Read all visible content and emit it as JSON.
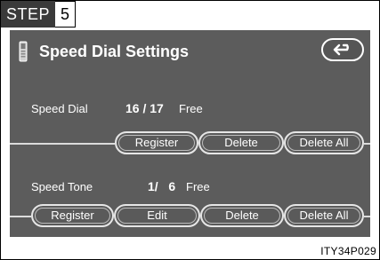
{
  "step": {
    "label": "STEP",
    "number": "5"
  },
  "header": {
    "title": "Speed Dial Settings",
    "icons": {
      "phone": "phone-icon",
      "back": "back-arrow-icon"
    }
  },
  "speed_dial": {
    "label": "Speed Dial",
    "count": "16 / 17",
    "free": "Free",
    "buttons": [
      "Register",
      "Delete",
      "Delete All"
    ]
  },
  "speed_tone": {
    "label": "Speed Tone",
    "count": "1/   6",
    "free": "Free",
    "buttons": [
      "Register",
      "Edit",
      "Delete",
      "Delete All"
    ]
  },
  "caption": "ITY34P029",
  "colors": {
    "screen": "#5c5c5c",
    "text": "#ffffff",
    "button_border": "#e6e6e6"
  }
}
